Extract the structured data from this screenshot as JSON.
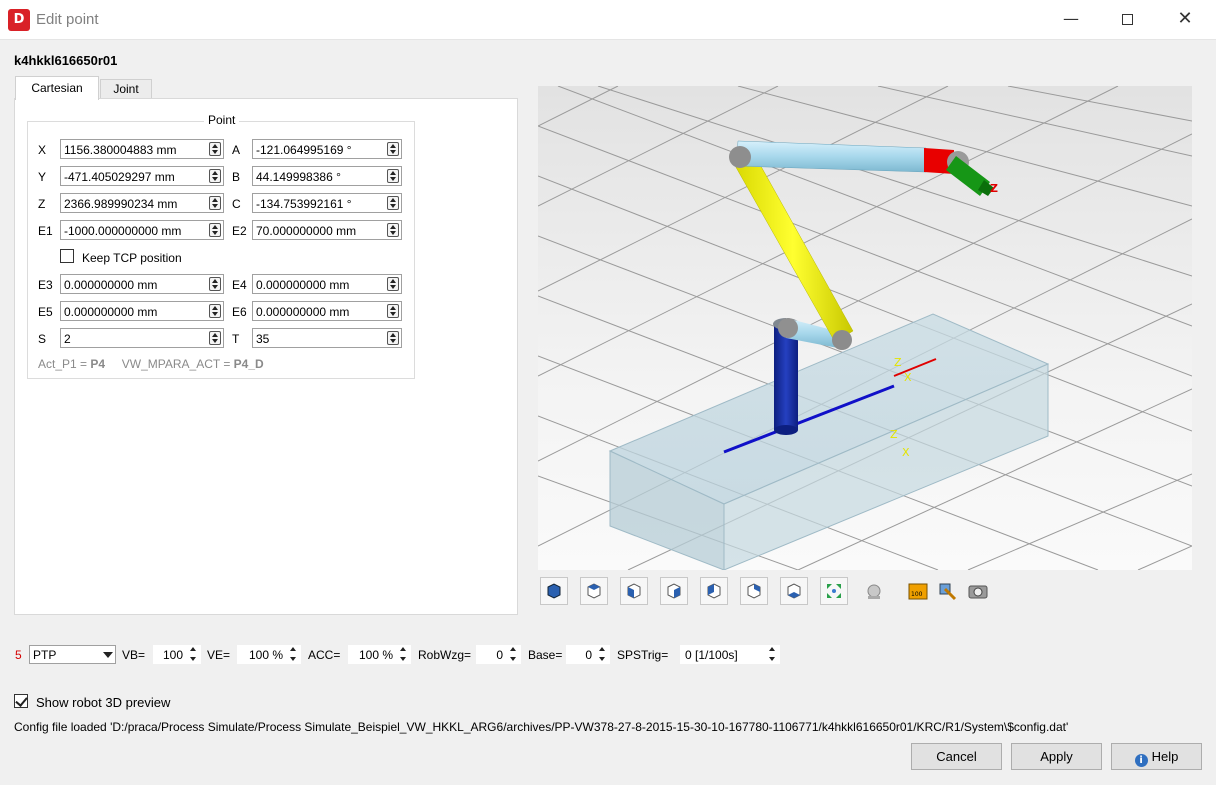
{
  "window": {
    "icon_text": "D",
    "title": "Edit point",
    "min_glyph": "—",
    "close_glyph": "✕"
  },
  "robot_name": "k4hkkl616650r01",
  "tabs": [
    {
      "label": "Cartesian",
      "active": true
    },
    {
      "label": "Joint",
      "active": false
    }
  ],
  "point": {
    "title": "Point",
    "fields": {
      "X": "1156.380004883 mm",
      "A": "-121.064995169 °",
      "Y": "-471.405029297 mm",
      "B": "44.149998386 °",
      "Z": "2366.989990234 mm",
      "C": "-134.753992161 °",
      "E1": "-1000.000000000 mm",
      "E2": "70.000000000 mm",
      "E3": "0.000000000 mm",
      "E4": "0.000000000 mm",
      "E5": "0.000000000 mm",
      "E6": "0.000000000 mm",
      "S": "2",
      "T": "35"
    },
    "labels": {
      "X": "X",
      "A": "A",
      "Y": "Y",
      "B": "B",
      "Z": "Z",
      "C": "C",
      "E1": "E1",
      "E2": "E2",
      "E3": "E3",
      "E4": "E4",
      "E5": "E5",
      "E6": "E6",
      "S": "S",
      "T": "T"
    },
    "keep_tcp_label": "Keep TCP position",
    "keep_tcp_checked": false,
    "act_p1_label": "Act_P1 = ",
    "act_p1_value": "P4",
    "mpara_label": "VW_MPARA_ACT = ",
    "mpara_value": "P4_D"
  },
  "viewport": {
    "axis_labels": {
      "z": "Z",
      "x": "X"
    }
  },
  "view_toolbar": {
    "icons": [
      "view-iso-icon",
      "view-top-icon",
      "view-front-icon",
      "view-right-icon",
      "view-left-icon",
      "view-back-icon",
      "view-bottom-icon",
      "fit-all-icon",
      "light-icon",
      "ruler-icon",
      "wrench-icon",
      "camera-icon"
    ],
    "ruler_text": "100"
  },
  "motion": {
    "number": "5",
    "type": "PTP",
    "vb_label": "VB=",
    "vb_value": "100",
    "ve_label": "VE=",
    "ve_value": "100 %",
    "acc_label": "ACC=",
    "acc_value": "100 %",
    "robwzg_label": "RobWzg=",
    "robwzg_value": "0",
    "base_label": "Base=",
    "base_value": "0",
    "spstrig_label": "SPSTrig=",
    "spstrig_value": "0 [1/100s]"
  },
  "show_preview": {
    "label": "Show robot 3D preview",
    "checked": true
  },
  "config_text": "Config file loaded 'D:/praca/Process Simulate/Process Simulate_Beispiel_VW_HKKL_ARG6/archives/PP-VW378-27-8-2015-15-30-10-167780-1106771/k4hkkl616650r01/KRC/R1/System\\$config.dat'",
  "buttons": {
    "cancel": "Cancel",
    "apply": "Apply",
    "help": "Help",
    "help_glyph": "i"
  },
  "colors": {
    "accent_red": "#d92127",
    "motion_number": "#d40000",
    "robot_link_yellow": "#f2f200",
    "robot_link_blue": "#1a2fa0",
    "robot_link_cyan": "#a8d8ec",
    "axis_red": "#e00000",
    "axis_blue": "#1010c8"
  }
}
